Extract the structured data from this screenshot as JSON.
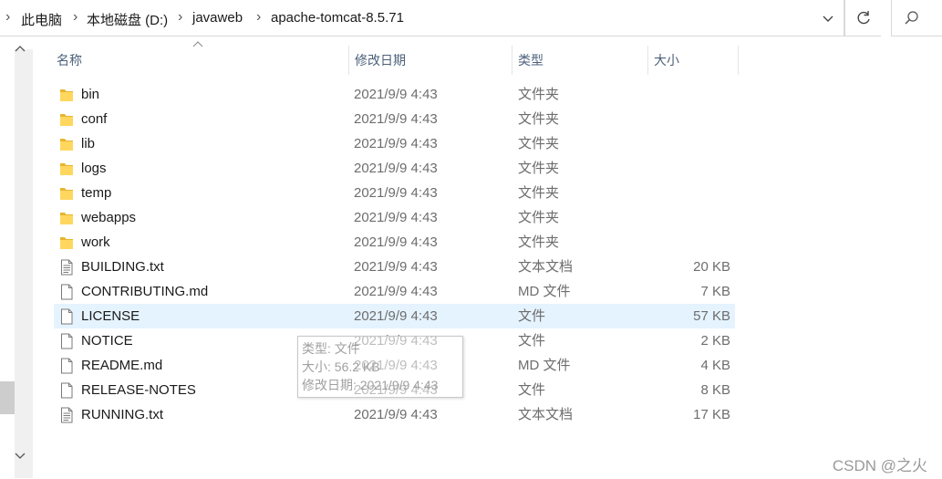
{
  "breadcrumb": {
    "items": [
      "此电脑",
      "本地磁盘 (D:)",
      "javaweb",
      "apache-tomcat-8.5.71"
    ]
  },
  "columns": {
    "name": "名称",
    "date": "修改日期",
    "type": "类型",
    "size": "大小"
  },
  "files": [
    {
      "name": "bin",
      "date": "2021/9/9 4:43",
      "type": "文件夹",
      "size": "",
      "kind": "folder"
    },
    {
      "name": "conf",
      "date": "2021/9/9 4:43",
      "type": "文件夹",
      "size": "",
      "kind": "folder"
    },
    {
      "name": "lib",
      "date": "2021/9/9 4:43",
      "type": "文件夹",
      "size": "",
      "kind": "folder"
    },
    {
      "name": "logs",
      "date": "2021/9/9 4:43",
      "type": "文件夹",
      "size": "",
      "kind": "folder"
    },
    {
      "name": "temp",
      "date": "2021/9/9 4:43",
      "type": "文件夹",
      "size": "",
      "kind": "folder"
    },
    {
      "name": "webapps",
      "date": "2021/9/9 4:43",
      "type": "文件夹",
      "size": "",
      "kind": "folder"
    },
    {
      "name": "work",
      "date": "2021/9/9 4:43",
      "type": "文件夹",
      "size": "",
      "kind": "folder"
    },
    {
      "name": "BUILDING.txt",
      "date": "2021/9/9 4:43",
      "type": "文本文档",
      "size": "20 KB",
      "kind": "text"
    },
    {
      "name": "CONTRIBUTING.md",
      "date": "2021/9/9 4:43",
      "type": "MD 文件",
      "size": "7 KB",
      "kind": "file"
    },
    {
      "name": "LICENSE",
      "date": "2021/9/9 4:43",
      "type": "文件",
      "size": "57 KB",
      "kind": "file",
      "selected": true
    },
    {
      "name": "NOTICE",
      "date": "2021/9/9 4:43",
      "type": "文件",
      "size": "2 KB",
      "kind": "file"
    },
    {
      "name": "README.md",
      "date": "2021/9/9 4:43",
      "type": "MD 文件",
      "size": "4 KB",
      "kind": "file"
    },
    {
      "name": "RELEASE-NOTES",
      "date": "2021/9/9 4:43",
      "type": "文件",
      "size": "8 KB",
      "kind": "file"
    },
    {
      "name": "RUNNING.txt",
      "date": "2021/9/9 4:43",
      "type": "文本文档",
      "size": "17 KB",
      "kind": "text"
    }
  ],
  "tooltip": {
    "type_line": "类型: 文件",
    "size_line": "大小: 56.2 KB",
    "date_line": "修改日期: 2021/9/9 4:43"
  },
  "watermark": "CSDN @之火",
  "icons": {
    "dropdown": "chevron-down-icon",
    "refresh": "refresh-icon",
    "search": "search-icon",
    "folder": "folder-icon",
    "file": "file-icon",
    "text": "text-file-icon"
  }
}
